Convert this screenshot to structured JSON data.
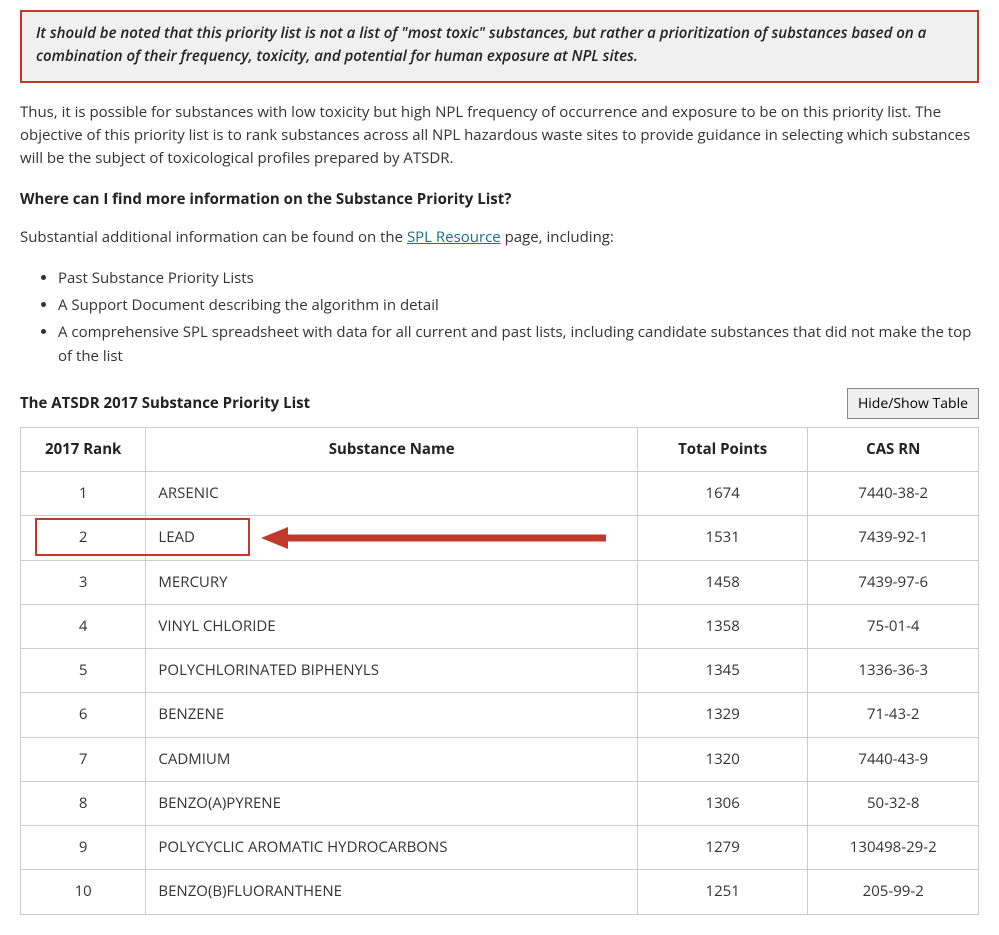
{
  "callout": "It should be noted that this priority list is not a list of \"most toxic\" substances, but rather a prioritization of substances based on a combination of their frequency, toxicity, and potential for human exposure at NPL sites.",
  "para1": "Thus, it is possible for substances with low toxicity but high NPL frequency of occurrence and exposure to be on this priority list. The objective of this priority list is to rank substances across all NPL hazardous waste sites to provide guidance in selecting which substances will be the subject of toxicological profiles prepared by ATSDR.",
  "heading1": "Where can I find more information on the Substance Priority List?",
  "para2_pre": "Substantial additional information can be found on the ",
  "para2_link": "SPL Resource",
  "para2_post": " page, including:",
  "bullets": [
    "Past Substance Priority Lists",
    "A Support Document describing the algorithm in detail",
    "A comprehensive SPL spreadsheet with data for all current and past lists, including candidate substances that did not make the top of the list"
  ],
  "table_title": "The ATSDR 2017 Substance Priority List",
  "toggle_label": "Hide/Show Table",
  "columns": {
    "rank": "2017 Rank",
    "name": "Substance Name",
    "points": "Total Points",
    "cas": "CAS RN"
  },
  "rows": [
    {
      "rank": "1",
      "name": "ARSENIC",
      "points": "1674",
      "cas": "7440-38-2"
    },
    {
      "rank": "2",
      "name": "LEAD",
      "points": "1531",
      "cas": "7439-92-1"
    },
    {
      "rank": "3",
      "name": "MERCURY",
      "points": "1458",
      "cas": "7439-97-6"
    },
    {
      "rank": "4",
      "name": "VINYL CHLORIDE",
      "points": "1358",
      "cas": "75-01-4"
    },
    {
      "rank": "5",
      "name": "POLYCHLORINATED BIPHENYLS",
      "points": "1345",
      "cas": "1336-36-3"
    },
    {
      "rank": "6",
      "name": "BENZENE",
      "points": "1329",
      "cas": "71-43-2"
    },
    {
      "rank": "7",
      "name": "CADMIUM",
      "points": "1320",
      "cas": "7440-43-9"
    },
    {
      "rank": "8",
      "name": "BENZO(A)PYRENE",
      "points": "1306",
      "cas": "50-32-8"
    },
    {
      "rank": "9",
      "name": "POLYCYCLIC AROMATIC HYDROCARBONS",
      "points": "1279",
      "cas": "130498-29-2"
    },
    {
      "rank": "10",
      "name": "BENZO(B)FLUORANTHENE",
      "points": "1251",
      "cas": "205-99-2"
    }
  ],
  "annotation": {
    "highlight_row_index": 1,
    "arrow_color": "#c0392b"
  }
}
